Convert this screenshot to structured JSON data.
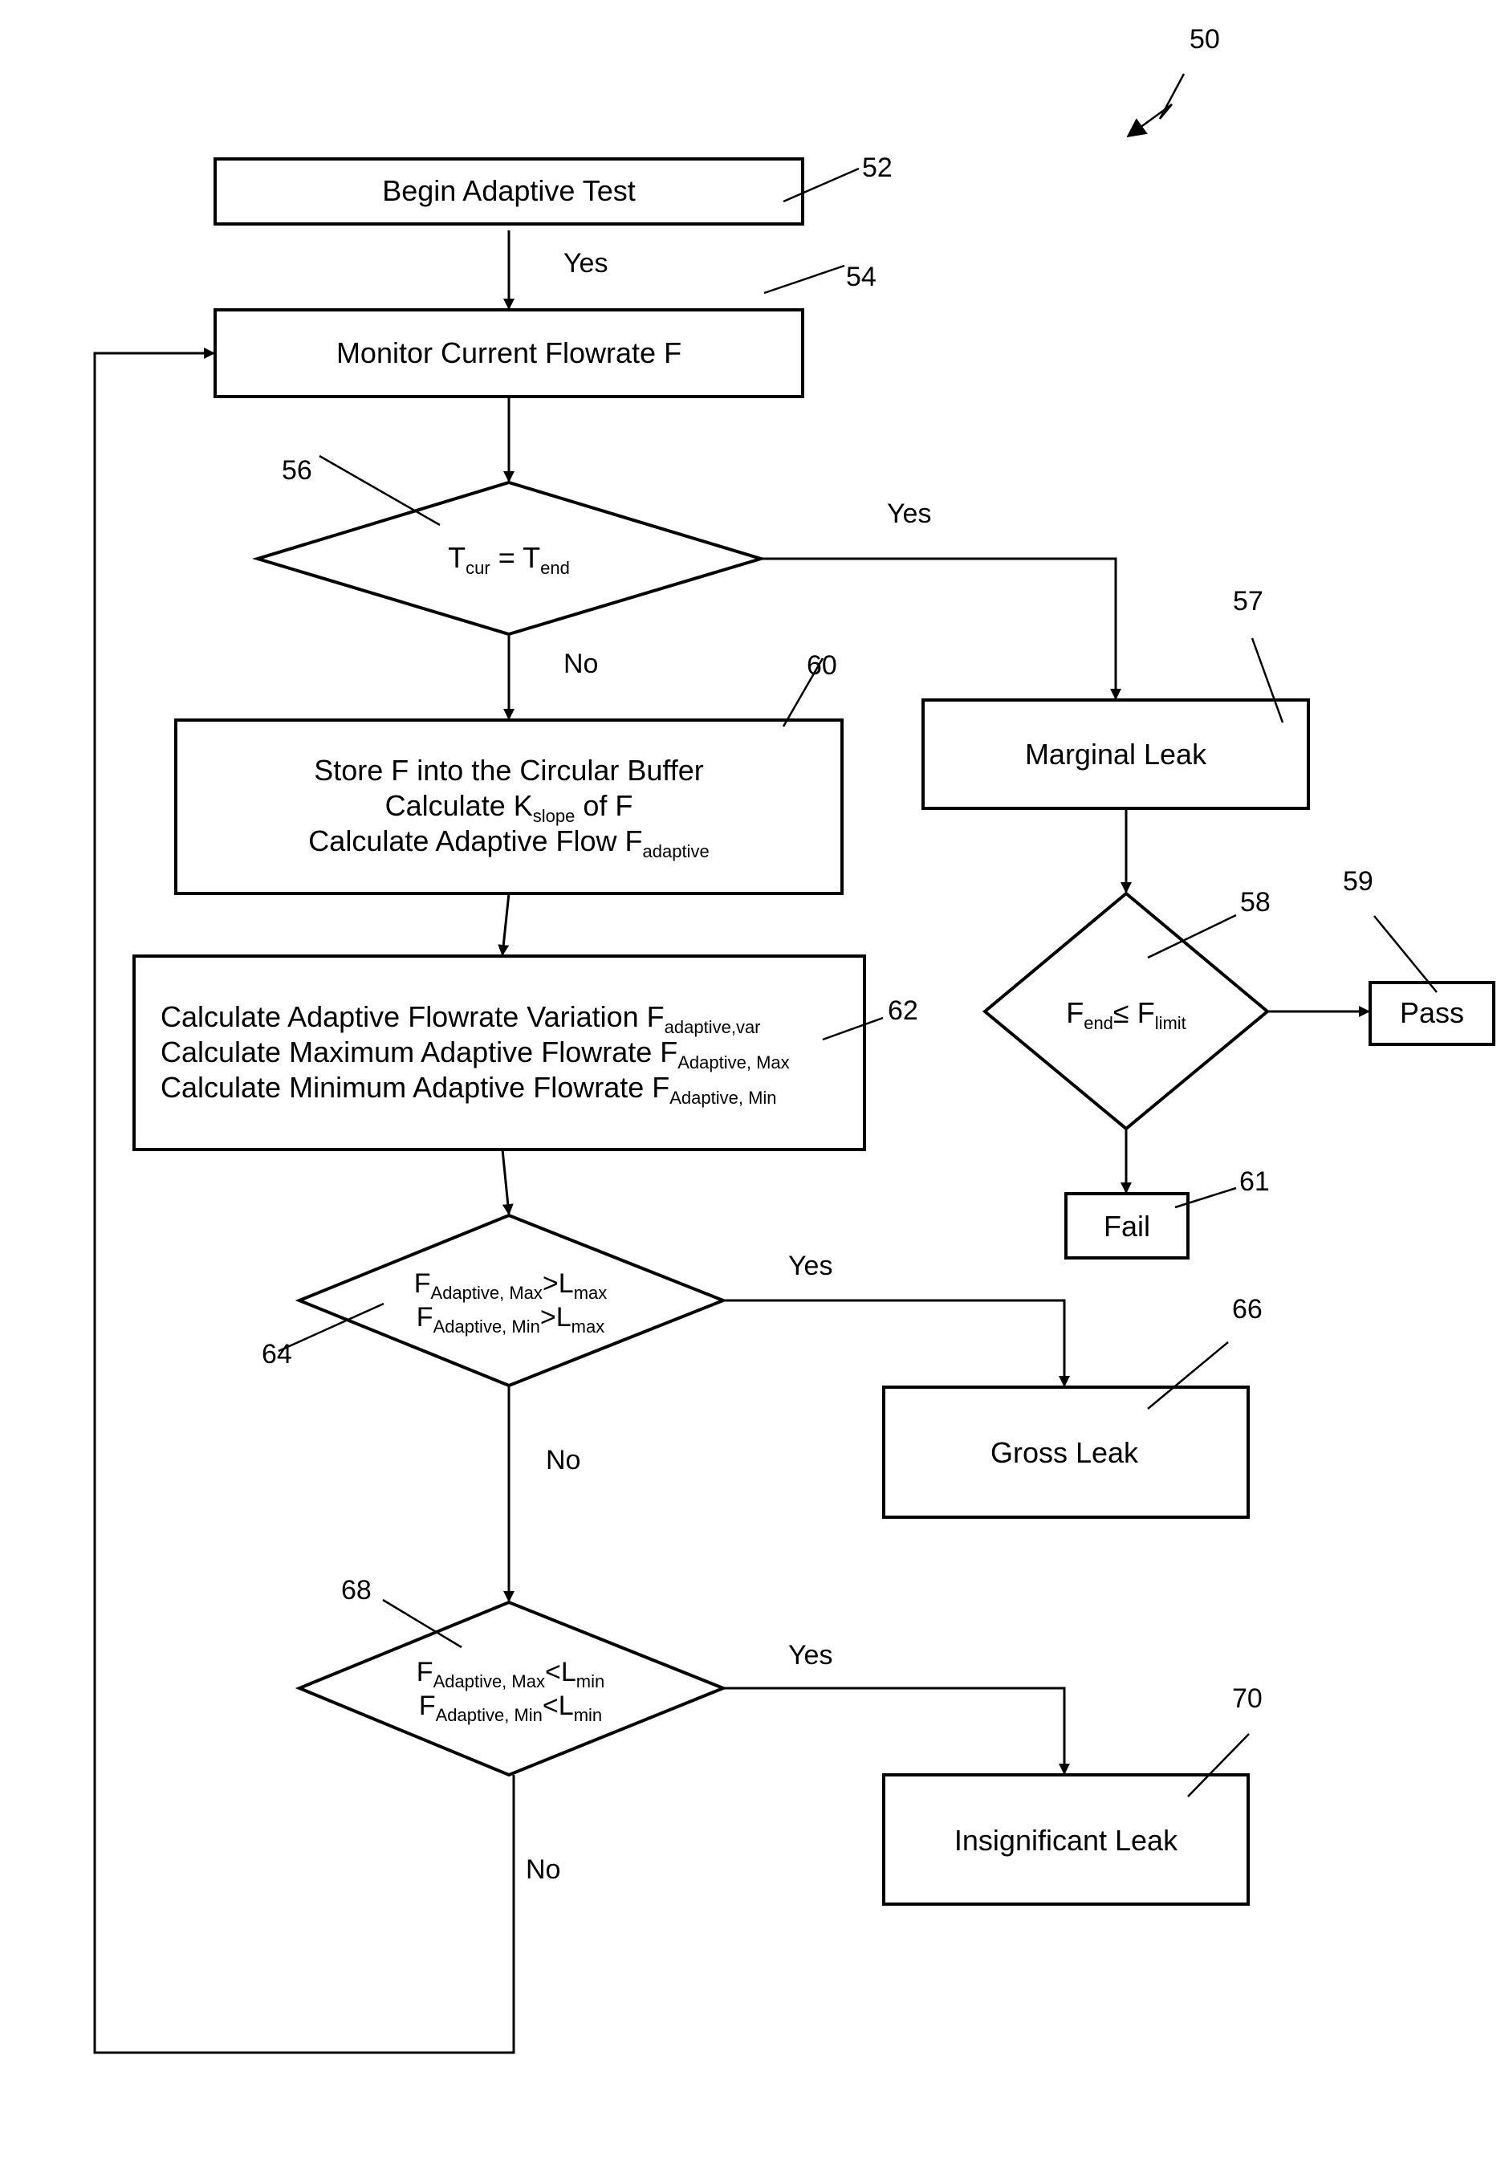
{
  "figure": {
    "reference": "50"
  },
  "nodes": {
    "begin": {
      "ref": "52",
      "text": "Begin Adaptive Test"
    },
    "monitor": {
      "ref": "54",
      "text": "Monitor Current Flowrate F"
    },
    "decision_time": {
      "ref": "56",
      "lhs": "T",
      "lhs_sub": "cur",
      "op": " = ",
      "rhs": "T",
      "rhs_sub": "end"
    },
    "marginal": {
      "ref": "57",
      "text": "Marginal Leak"
    },
    "decision_limit": {
      "ref": "58",
      "lhs": "F",
      "lhs_sub": "end",
      "op": "≤ ",
      "rhs": "F",
      "rhs_sub": "limit"
    },
    "pass": {
      "ref": "59",
      "text": "Pass"
    },
    "fail": {
      "ref": "61",
      "text": "Fail"
    },
    "store": {
      "ref": "60",
      "line1": "Store F into the Circular Buffer",
      "line2_pre": "Calculate K",
      "line2_sub": "slope",
      "line2_post": " of F",
      "line3_pre": "Calculate Adaptive Flow F",
      "line3_sub": "adaptive"
    },
    "calc": {
      "ref": "62",
      "line1_pre": "Calculate Adaptive Flowrate Variation F",
      "line1_sub": "adaptive,var",
      "line2_pre": "Calculate Maximum Adaptive Flowrate F",
      "line2_sub": "Adaptive, Max",
      "line3_pre": "Calculate Minimum Adaptive Flowrate F",
      "line3_sub": "Adaptive, Min"
    },
    "decision_gross": {
      "ref": "64",
      "l1_f": "F",
      "l1_sub": "Adaptive, Max",
      "l1_op": ">",
      "l1_l": "L",
      "l1_lsub": "max",
      "l2_f": "F",
      "l2_sub": "Adaptive, Min",
      "l2_op": ">",
      "l2_l": "L",
      "l2_lsub": "max"
    },
    "gross": {
      "ref": "66",
      "text": "Gross Leak"
    },
    "decision_insig": {
      "ref": "68",
      "l1_f": "F",
      "l1_sub": "Adaptive, Max",
      "l1_op": "<",
      "l1_l": "L",
      "l1_lsub": "min",
      "l2_f": "F",
      "l2_sub": "Adaptive, Min",
      "l2_op": "<",
      "l2_l": "L",
      "l2_lsub": "min"
    },
    "insignificant": {
      "ref": "70",
      "text": "Insignificant Leak"
    }
  },
  "edge_labels": {
    "begin_to_monitor": "Yes",
    "time_yes": "Yes",
    "time_no": "No",
    "gross_yes": "Yes",
    "gross_no": "No",
    "insig_yes": "Yes",
    "insig_no": "No"
  }
}
